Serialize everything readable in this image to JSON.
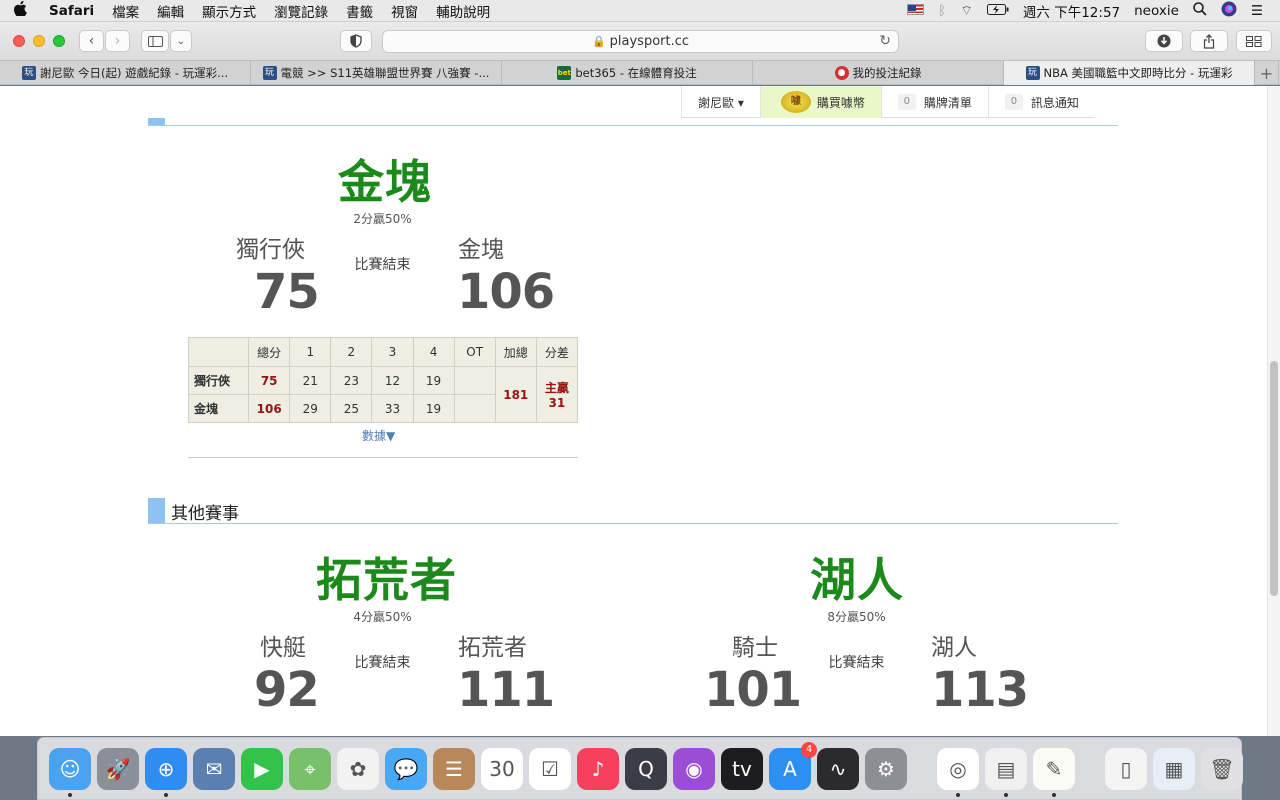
{
  "menubar": {
    "apple": "",
    "app": "Safari",
    "items": [
      "檔案",
      "編輯",
      "顯示方式",
      "瀏覽記錄",
      "書籤",
      "視窗",
      "輔助說明"
    ],
    "clock": "週六 下午12:57",
    "user": "neoxie"
  },
  "browser": {
    "url": "playsport.cc",
    "tabs": [
      {
        "label": "謝尼歐 今日(起) 遊戲紀錄 - 玩運彩...",
        "favicon": "玩",
        "active": false
      },
      {
        "label": "電競 >> S11英雄聯盟世界賽 八強賽 -...",
        "favicon": "玩",
        "active": false
      },
      {
        "label": "bet365 - 在線體育投注",
        "favicon": "bet365",
        "active": false
      },
      {
        "label": "我的投注紀錄",
        "favicon": "ball",
        "active": false
      },
      {
        "label": "NBA 美國職籃中文即時比分 - 玩運彩",
        "favicon": "玩",
        "active": true
      }
    ]
  },
  "site": {
    "user_menu": "謝尼歐 ▾",
    "buy_coins": "購買噱幣",
    "coin_icon_text": "噱",
    "cart_count": "0",
    "cart_label": "購牌清單",
    "notify_count": "0",
    "notify_label": "訊息通知"
  },
  "main_game": {
    "winner": "金塊",
    "spread": "2分贏50%",
    "status": "比賽結束",
    "away": {
      "name": "獨行俠",
      "score": "75"
    },
    "home": {
      "name": "金塊",
      "score": "106"
    },
    "box": {
      "headers": [
        "",
        "總分",
        "1",
        "2",
        "3",
        "4",
        "OT",
        "加總",
        "分差"
      ],
      "rows": [
        {
          "team": "獨行俠",
          "total": "75",
          "q": [
            "21",
            "23",
            "12",
            "19"
          ],
          "ot": ""
        },
        {
          "team": "金塊",
          "total": "106",
          "q": [
            "29",
            "25",
            "33",
            "19"
          ],
          "ot": ""
        }
      ],
      "sum": "181",
      "diff_label": "主贏",
      "diff_value": "31"
    },
    "more_link": "數據▼"
  },
  "other_section": {
    "title": "其他賽事"
  },
  "other_games": [
    {
      "winner": "拓荒者",
      "spread": "4分贏50%",
      "status": "比賽結束",
      "away": {
        "name": "快艇",
        "score": "92"
      },
      "home": {
        "name": "拓荒者",
        "score": "111"
      }
    },
    {
      "winner": "湖人",
      "spread": "8分贏50%",
      "status": "比賽結束",
      "away": {
        "name": "騎士",
        "score": "101"
      },
      "home": {
        "name": "湖人",
        "score": "113"
      }
    }
  ],
  "dock": {
    "apps": [
      {
        "name": "finder",
        "color": "#4aa3f0",
        "glyph": "☺",
        "running": true
      },
      {
        "name": "launchpad",
        "color": "#8a8f99",
        "glyph": "🚀",
        "running": false
      },
      {
        "name": "safari",
        "color": "#2f8cf0",
        "glyph": "⊕",
        "running": true
      },
      {
        "name": "mail",
        "color": "#5a7fb0",
        "glyph": "✉",
        "running": false
      },
      {
        "name": "facetime",
        "color": "#33c24a",
        "glyph": "▶",
        "running": false
      },
      {
        "name": "maps",
        "color": "#79c06b",
        "glyph": "⌖",
        "running": false
      },
      {
        "name": "photos",
        "color": "#f2f2f2",
        "glyph": "✿",
        "running": false
      },
      {
        "name": "messages",
        "color": "#48a8f5",
        "glyph": "💬",
        "running": false
      },
      {
        "name": "contacts",
        "color": "#b8875a",
        "glyph": "☰",
        "running": false
      },
      {
        "name": "calendar",
        "color": "#ffffff",
        "glyph": "30",
        "running": false
      },
      {
        "name": "reminders",
        "color": "#ffffff",
        "glyph": "☑",
        "running": false
      },
      {
        "name": "music",
        "color": "#f6405c",
        "glyph": "♪",
        "running": false
      },
      {
        "name": "quicktime",
        "color": "#3c3c46",
        "glyph": "Q",
        "running": false
      },
      {
        "name": "podcasts",
        "color": "#9b4dd8",
        "glyph": "◉",
        "running": false
      },
      {
        "name": "apple-tv",
        "color": "#1d1d1f",
        "glyph": "tv",
        "running": false
      },
      {
        "name": "app-store",
        "color": "#2e8ff2",
        "glyph": "A",
        "running": false,
        "badge": "4"
      },
      {
        "name": "voice-memos",
        "color": "#2b2b2e",
        "glyph": "∿",
        "running": false
      },
      {
        "name": "system-preferences",
        "color": "#8d8f94",
        "glyph": "⚙",
        "running": false
      }
    ],
    "recent": [
      {
        "name": "chrome",
        "color": "#ffffff",
        "glyph": "◎",
        "running": true
      },
      {
        "name": "preview",
        "color": "#f0f0f0",
        "glyph": "▤",
        "running": true
      },
      {
        "name": "textedit",
        "color": "#fbfbf6",
        "glyph": "✎",
        "running": true
      }
    ],
    "stacks": [
      {
        "name": "documents-stack",
        "color": "#f4f4f4",
        "glyph": "▯",
        "running": false
      },
      {
        "name": "downloads-stack",
        "color": "#e8eef6",
        "glyph": "▦",
        "running": false
      },
      {
        "name": "trash",
        "color": "#e0e0e2",
        "glyph": "🗑",
        "running": false
      }
    ]
  }
}
